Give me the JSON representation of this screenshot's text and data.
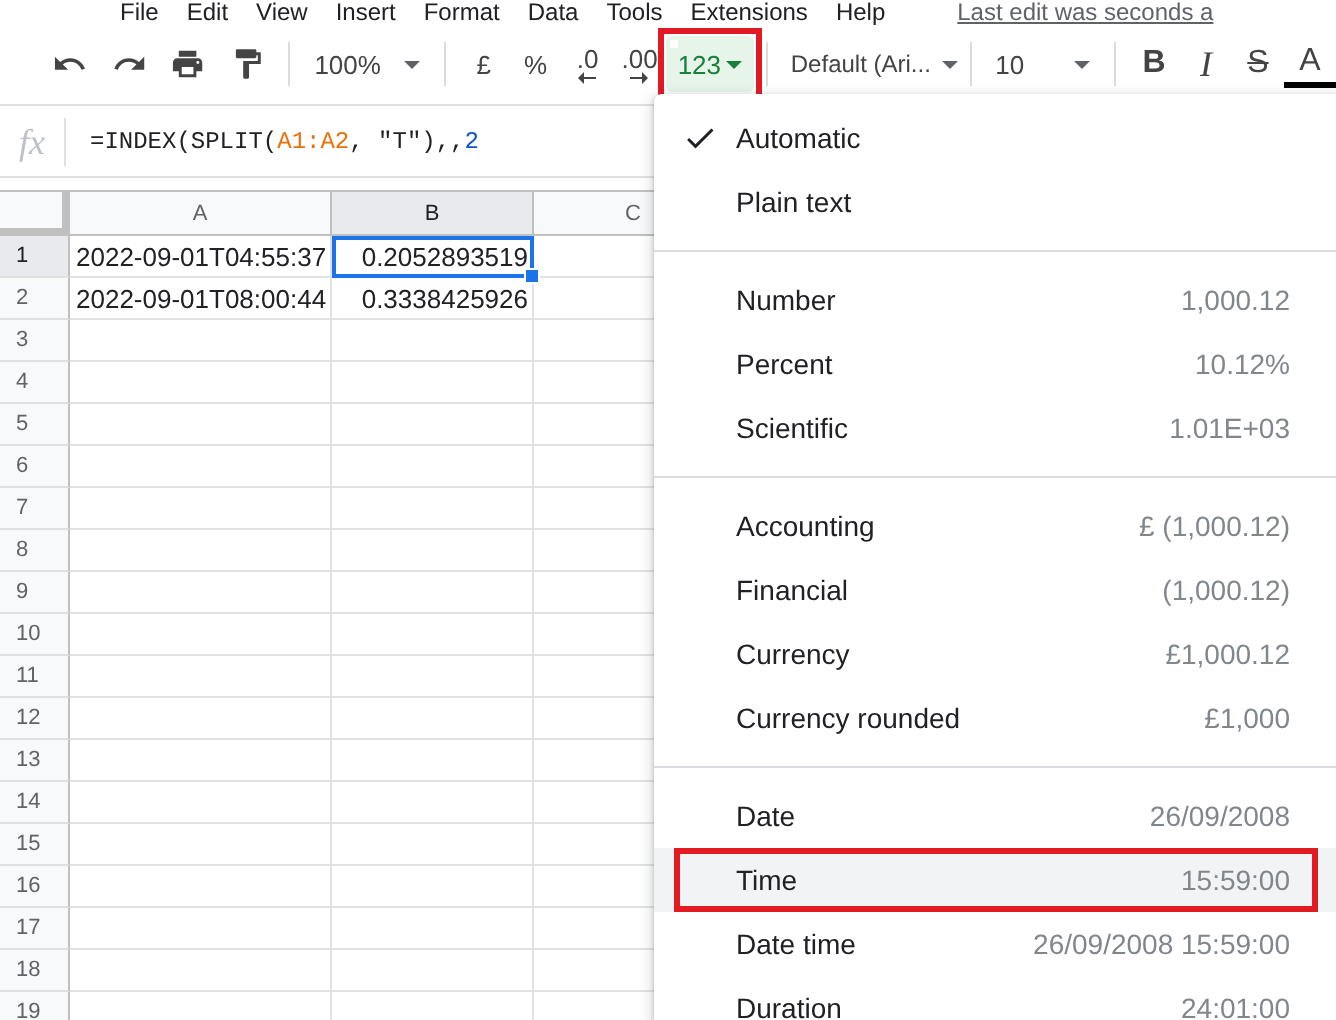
{
  "menu_bar": {
    "items": [
      "File",
      "Edit",
      "View",
      "Insert",
      "Format",
      "Data",
      "Tools",
      "Extensions",
      "Help"
    ],
    "last_edit": "Last edit was seconds a"
  },
  "toolbar": {
    "items": [
      {
        "kind": "undo"
      },
      {
        "kind": "redo"
      },
      {
        "kind": "print"
      },
      {
        "kind": "paintformat"
      },
      {
        "kind": "sep"
      },
      {
        "kind": "zoom",
        "label": "100%"
      },
      {
        "kind": "sep"
      },
      {
        "kind": "currency",
        "label": "£"
      },
      {
        "kind": "percent",
        "label": "%"
      },
      {
        "kind": "decrease",
        "label": ".0"
      },
      {
        "kind": "increase",
        "label": ".00"
      },
      {
        "kind": "format",
        "label": "123",
        "active": true,
        "highlighted": true
      },
      {
        "kind": "sep"
      },
      {
        "kind": "font",
        "label": "Default (Ari..."
      },
      {
        "kind": "sep"
      },
      {
        "kind": "size",
        "label": "10"
      },
      {
        "kind": "sep"
      },
      {
        "kind": "bold",
        "label": "B"
      },
      {
        "kind": "italic",
        "label": "I"
      },
      {
        "kind": "strike",
        "label": "S"
      },
      {
        "kind": "textcolor",
        "label": "A"
      }
    ]
  },
  "formula_bar": {
    "label": "fx",
    "formula": [
      {
        "kind": "text",
        "text": "=INDEX(SPLIT("
      },
      {
        "kind": "range",
        "text": "A1:A2"
      },
      {
        "kind": "text",
        "text": ", \"T\"),,"
      },
      {
        "kind": "number",
        "text": "2"
      }
    ]
  },
  "sheet": {
    "columns": [
      {
        "label": "A",
        "selected": false
      },
      {
        "label": "B",
        "selected": true
      },
      {
        "label": "C",
        "selected": false
      }
    ],
    "rows": [
      {
        "label": "1",
        "selected": true,
        "cells": [
          {
            "text": "2022-09-01T04:55:37",
            "selected": false
          },
          {
            "text": "0.2052893519",
            "selected": true
          }
        ]
      },
      {
        "label": "2",
        "selected": false,
        "cells": [
          {
            "text": "2022-09-01T08:00:44",
            "selected": false
          },
          {
            "text": "0.3338425926",
            "selected": false
          }
        ]
      },
      {
        "label": "3",
        "selected": false,
        "cells": []
      },
      {
        "label": "4",
        "selected": false,
        "cells": []
      },
      {
        "label": "5",
        "selected": false,
        "cells": []
      },
      {
        "label": "6",
        "selected": false,
        "cells": []
      },
      {
        "label": "7",
        "selected": false,
        "cells": []
      },
      {
        "label": "8",
        "selected": false,
        "cells": []
      },
      {
        "label": "9",
        "selected": false,
        "cells": []
      },
      {
        "label": "10",
        "selected": false,
        "cells": []
      },
      {
        "label": "11",
        "selected": false,
        "cells": []
      },
      {
        "label": "12",
        "selected": false,
        "cells": []
      },
      {
        "label": "13",
        "selected": false,
        "cells": []
      },
      {
        "label": "14",
        "selected": false,
        "cells": []
      },
      {
        "label": "15",
        "selected": false,
        "cells": []
      },
      {
        "label": "16",
        "selected": false,
        "cells": []
      },
      {
        "label": "17",
        "selected": false,
        "cells": []
      },
      {
        "label": "18",
        "selected": false,
        "cells": []
      },
      {
        "label": "19",
        "selected": false,
        "cells": []
      }
    ]
  },
  "format_menu": {
    "sections": [
      [
        {
          "label": "Automatic",
          "checked": true,
          "selected": false,
          "highlighted": false
        },
        {
          "label": "Plain text",
          "checked": false,
          "selected": false,
          "highlighted": false
        }
      ],
      [
        {
          "label": "Number",
          "example": "1,000.12",
          "checked": false,
          "selected": false,
          "highlighted": false
        },
        {
          "label": "Percent",
          "example": "10.12%",
          "checked": false,
          "selected": false,
          "highlighted": false
        },
        {
          "label": "Scientific",
          "example": "1.01E+03",
          "checked": false,
          "selected": false,
          "highlighted": false
        }
      ],
      [
        {
          "label": "Accounting",
          "example": "£ (1,000.12)",
          "checked": false,
          "selected": false,
          "highlighted": false
        },
        {
          "label": "Financial",
          "example": "(1,000.12)",
          "checked": false,
          "selected": false,
          "highlighted": false
        },
        {
          "label": "Currency",
          "example": "£1,000.12",
          "checked": false,
          "selected": false,
          "highlighted": false
        },
        {
          "label": "Currency rounded",
          "example": "£1,000",
          "checked": false,
          "selected": false,
          "highlighted": false
        }
      ],
      [
        {
          "label": "Date",
          "example": "26/09/2008",
          "checked": false,
          "selected": false,
          "highlighted": false
        },
        {
          "label": "Time",
          "example": "15:59:00",
          "checked": false,
          "selected": true,
          "highlighted": true
        },
        {
          "label": "Date time",
          "example": "26/09/2008 15:59:00",
          "checked": false,
          "selected": false,
          "highlighted": false
        },
        {
          "label": "Duration",
          "example": "24:01:00",
          "checked": false,
          "selected": false,
          "highlighted": false
        }
      ]
    ]
  }
}
